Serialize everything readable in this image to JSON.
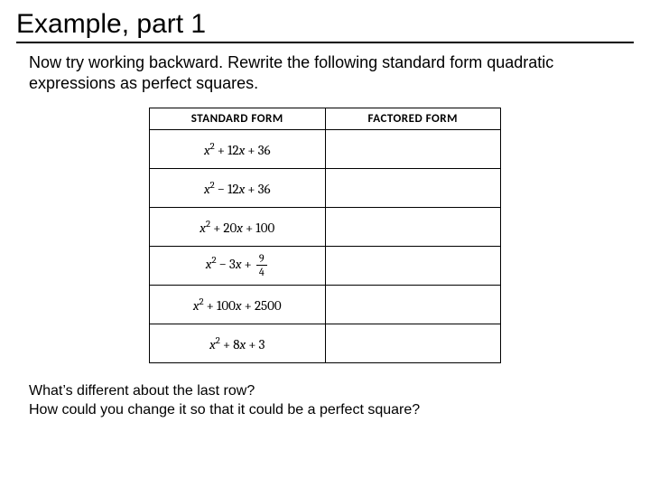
{
  "title": "Example, part 1",
  "intro": "Now try working backward.  Rewrite the following standard form quadratic expressions as perfect squares.",
  "table": {
    "headers": {
      "std": "STANDARD FORM",
      "fact": "FACTORED FORM"
    },
    "rows": [
      {
        "a": "1",
        "b_sign": "+",
        "b": "12",
        "c_sign": "+",
        "c": "36",
        "c_frac": null
      },
      {
        "a": "1",
        "b_sign": "−",
        "b": "12",
        "c_sign": "+",
        "c": "36",
        "c_frac": null
      },
      {
        "a": "1",
        "b_sign": "+",
        "b": "20",
        "c_sign": "+",
        "c": "100",
        "c_frac": null
      },
      {
        "a": "1",
        "b_sign": "−",
        "b": "3",
        "c_sign": "+",
        "c": null,
        "c_frac": {
          "num": "9",
          "den": "4"
        }
      },
      {
        "a": "1",
        "b_sign": "+",
        "b": "100",
        "c_sign": "+",
        "c": "2500",
        "c_frac": null
      },
      {
        "a": "1",
        "b_sign": "+",
        "b": "8",
        "c_sign": "+",
        "c": "3",
        "c_frac": null
      }
    ]
  },
  "outro_1": "What’s different about the last row?",
  "outro_2": "How could you change it so that it could be a perfect square?"
}
